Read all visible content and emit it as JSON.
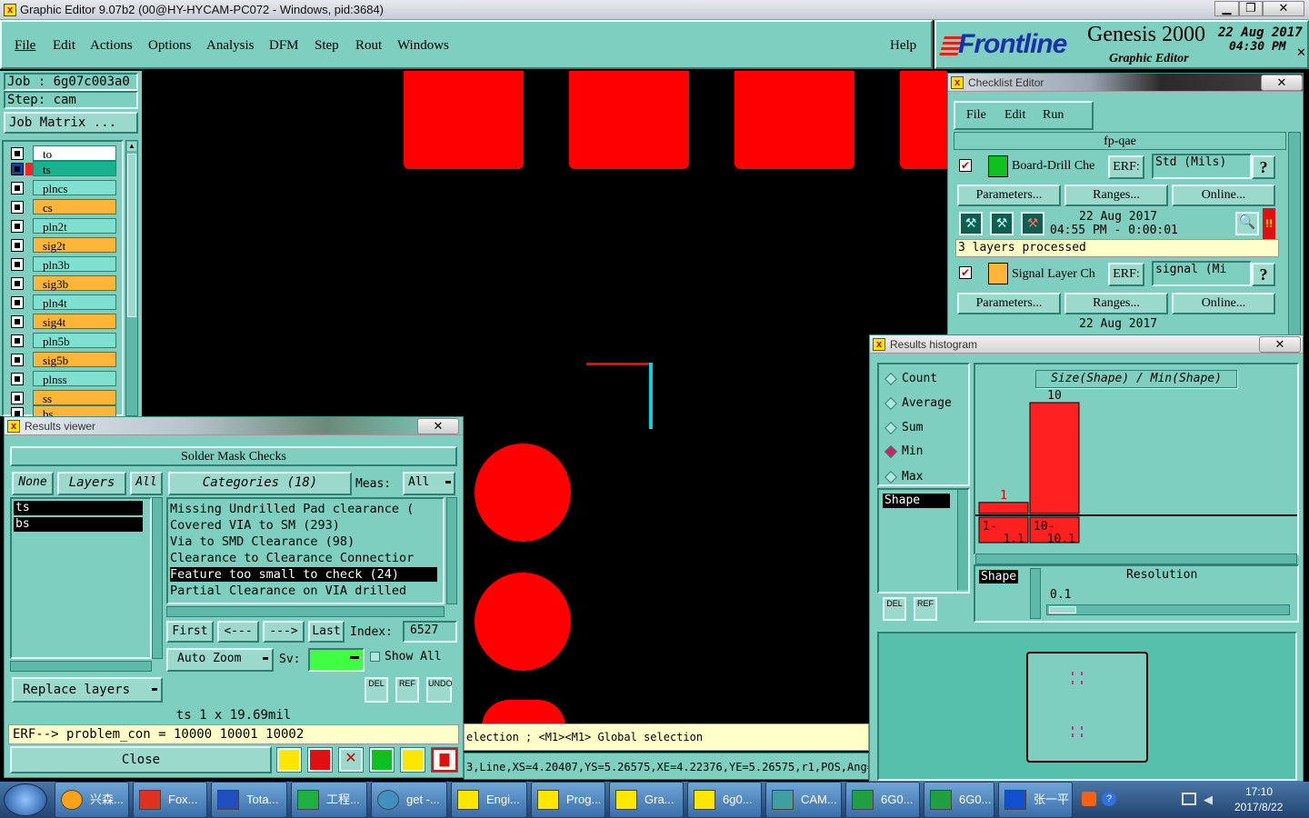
{
  "window": {
    "title": "Graphic Editor 9.07b2 (00@HY-HYCAM-PC072 - Windows, pid:3684)"
  },
  "menu": {
    "items": [
      "File",
      "Edit",
      "Actions",
      "Options",
      "Analysis",
      "DFM",
      "Step",
      "Rout",
      "Windows"
    ],
    "help": "Help"
  },
  "brand": {
    "logo": "Frontline",
    "product": "Genesis 2000",
    "subtitle": "Graphic Editor",
    "date": "22 Aug 2017",
    "time": "04:30 PM"
  },
  "job": {
    "job": "Job  : 6g07c003a0",
    "step": "Step: cam",
    "matrix": "Job Matrix ..."
  },
  "layers": [
    "to",
    "ts",
    "plncs",
    "cs",
    "pln2t",
    "sig2t",
    "pln3b",
    "sig3b",
    "pln4t",
    "sig4t",
    "pln5b",
    "sig5b",
    "plnss",
    "ss",
    "bs"
  ],
  "checklist": {
    "title": "Checklist Editor",
    "menu": [
      "File",
      "Edit",
      "Run"
    ],
    "name": "fp-qae",
    "items": [
      {
        "name": "Board-Drill Che",
        "erf": "ERF:",
        "erf_value": "Std (Mils)",
        "date": "22 Aug 2017",
        "time": "04:55 PM - 0:00:01",
        "status": "3 layers processed"
      },
      {
        "name": "Signal Layer Ch",
        "erf": "ERF:",
        "erf_value": "signal (Mi",
        "date": "22 Aug 2017"
      }
    ],
    "buttons": [
      "Parameters...",
      "Ranges...",
      "Online..."
    ],
    "help": "?"
  },
  "histogram": {
    "title": "Results histogram",
    "options": [
      "Count",
      "Average",
      "Sum",
      "Min",
      "Max"
    ],
    "selected": "Min",
    "list_item": "Shape",
    "axis_title": "Size(Shape) / Min(Shape)",
    "shape_label": "Shape",
    "resolution_label": "Resolution",
    "resolution_value": "0.1",
    "del": "DEL",
    "ref": "REF"
  },
  "chart_data": {
    "type": "bar",
    "title": "Size(Shape) / Min(Shape)",
    "categories": [
      "1-1.1",
      "10-10.1"
    ],
    "category_labels": [
      [
        "1-",
        "1.1"
      ],
      [
        "10-",
        "10.1"
      ]
    ],
    "values": [
      1,
      10
    ],
    "ylim": [
      0,
      10
    ],
    "xlabel": "",
    "ylabel": ""
  },
  "results": {
    "title": "Results viewer",
    "header": "Solder Mask Checks",
    "none": "None",
    "layers_btn": "Layers",
    "all": "All",
    "categories": "Categories (18)",
    "meas_label": "Meas:",
    "meas_value": "All",
    "layer_list": [
      "ts",
      "bs"
    ],
    "category_list": [
      "Missing Undrilled Pad clearance (",
      "Covered VIA to SM (293)",
      "Via to SMD Clearance (98)",
      "Clearance to Clearance Connectior",
      "Feature too small to check (24)",
      "Partial Clearance on VIA drilled"
    ],
    "selected_category": "Feature too small to check (24)",
    "nav": [
      "First",
      "<---",
      "--->",
      "Last"
    ],
    "index_label": "Index:",
    "index_value": "6527",
    "auto_zoom": "Auto Zoom",
    "sv": "Sv:",
    "show_all": "Show All",
    "replace": "Replace layers",
    "del": "DEL",
    "ref": "REF",
    "undo": "UNDO",
    "measure": "ts 1 x 19.69mil",
    "erf_line": "ERF--> problem_con = 10000 10001 10002",
    "close": "Close"
  },
  "status": {
    "line1": "election ; <M1><M1> Global selection",
    "line2": "3,Line,XS=4.20407,YS=5.26575,XE=4.22376,YE=5.26575,r1,POS,Ang=0"
  },
  "taskbar": {
    "items": [
      "兴森...",
      "Fox...",
      "Tota...",
      "工程...",
      "get -...",
      "Engi...",
      "Prog...",
      "Gra...",
      "6g0...",
      "CAM...",
      "6G0...",
      "6G0...",
      "张一平"
    ],
    "time": "17:10",
    "date": "2017/8/22"
  },
  "colors": {
    "teal": "#7fcfc1",
    "pad": "#ff0000",
    "highlight": "#ffff00",
    "selection": "#00d0e0"
  }
}
